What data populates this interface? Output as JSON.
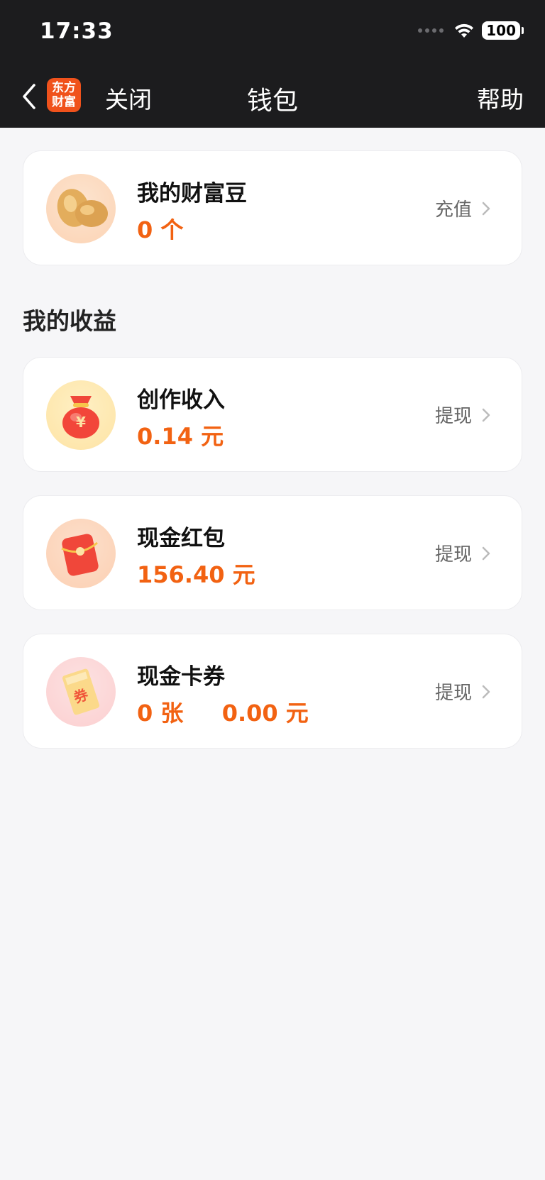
{
  "status_bar": {
    "time": "17:33",
    "battery": "100"
  },
  "nav": {
    "logo_text_line1": "东方",
    "logo_text_line2": "财富",
    "close_label": "关闭",
    "title": "钱包",
    "help_label": "帮助"
  },
  "beans": {
    "title": "我的财富豆",
    "count": "0",
    "unit": "个",
    "action": "充值"
  },
  "earnings_section_title": "我的收益",
  "cards": [
    {
      "title": "创作收入",
      "value": "0.14",
      "unit": "元",
      "action": "提现"
    },
    {
      "title": "现金红包",
      "value": "156.40",
      "unit": "元",
      "action": "提现"
    },
    {
      "title": "现金卡券",
      "count": "0",
      "count_unit": "张",
      "value": "0.00",
      "unit": "元",
      "action": "提现"
    }
  ],
  "colors": {
    "accent": "#f26212",
    "topbar": "#1c1c1e",
    "background": "#f6f6f8"
  },
  "icons": [
    "back-icon",
    "app-logo",
    "beans-icon",
    "money-bag-icon",
    "red-envelope-icon",
    "coupon-icon",
    "chevron-right-icon"
  ]
}
